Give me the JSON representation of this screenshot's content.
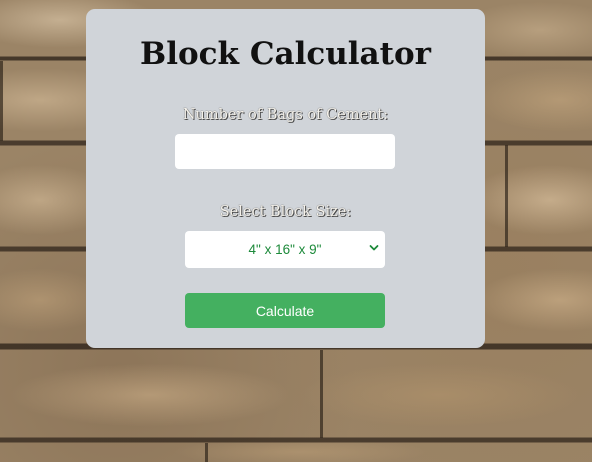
{
  "page": {
    "title": "Block Calculator"
  },
  "form": {
    "bags_label": "Number of Bags of Cement:",
    "bags_value": "",
    "size_label": "Select Block Size:",
    "size_selected": "4\" x 16\" x 9\"",
    "calculate_label": "Calculate"
  },
  "icons": {
    "dropdown": "chevron-down-icon"
  },
  "colors": {
    "card_background": "#d0d4d9",
    "button_background": "#44b060",
    "select_text": "#1c8a3a"
  }
}
